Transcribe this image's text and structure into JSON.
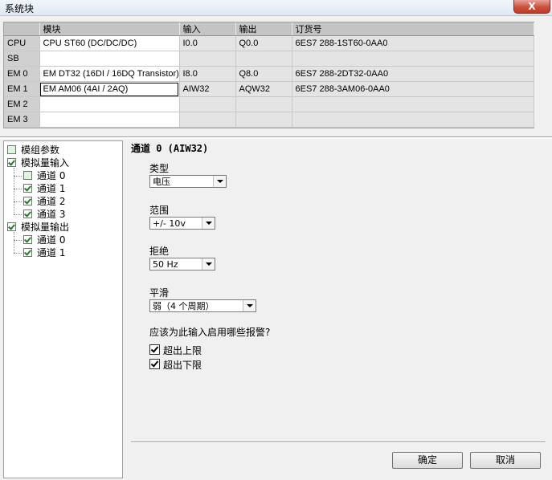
{
  "window": {
    "title": "系统块",
    "close_glyph": "X"
  },
  "table": {
    "headers": [
      "",
      "模块",
      "输入",
      "输出",
      "订货号"
    ],
    "rows": [
      {
        "slot": "CPU",
        "module": "CPU ST60 (DC/DC/DC)",
        "input": "I0.0",
        "output": "Q0.0",
        "order": "6ES7 288-1ST60-0AA0",
        "selected": false
      },
      {
        "slot": "SB",
        "module": "",
        "input": "",
        "output": "",
        "order": "",
        "selected": false
      },
      {
        "slot": "EM 0",
        "module": "EM DT32 (16DI / 16DQ Transistor)",
        "input": "I8.0",
        "output": "Q8.0",
        "order": "6ES7 288-2DT32-0AA0",
        "selected": false
      },
      {
        "slot": "EM 1",
        "module": "EM AM06 (4AI / 2AQ)",
        "input": "AIW32",
        "output": "AQW32",
        "order": "6ES7 288-3AM06-0AA0",
        "selected": true
      },
      {
        "slot": "EM 2",
        "module": "",
        "input": "",
        "output": "",
        "order": "",
        "selected": false
      },
      {
        "slot": "EM 3",
        "module": "",
        "input": "",
        "output": "",
        "order": "",
        "selected": false
      }
    ]
  },
  "tree": {
    "items": [
      {
        "label": "模组参数",
        "checked": false,
        "level": 0
      },
      {
        "label": "模拟量输入",
        "checked": true,
        "level": 0
      },
      {
        "label": "通道 0",
        "checked": false,
        "level": 1
      },
      {
        "label": "通道 1",
        "checked": true,
        "level": 1
      },
      {
        "label": "通道 2",
        "checked": true,
        "level": 1
      },
      {
        "label": "通道 3",
        "checked": true,
        "level": 1
      },
      {
        "label": "模拟量输出",
        "checked": true,
        "level": 0
      },
      {
        "label": "通道 0",
        "checked": true,
        "level": 1
      },
      {
        "label": "通道 1",
        "checked": true,
        "level": 1
      }
    ]
  },
  "panel": {
    "heading": "通道 0 (AIW32)",
    "type_label": "类型",
    "type_value": "电压",
    "range_label": "范围",
    "range_value": "+/- 10v",
    "reject_label": "拒绝",
    "reject_value": "50 Hz",
    "smooth_label": "平滑",
    "smooth_value": "弱（4 个周期）",
    "alarm_question": "应该为此输入启用哪些报警?",
    "alarm_upper_label": "超出上限",
    "alarm_upper_checked": true,
    "alarm_lower_label": "超出下限",
    "alarm_lower_checked": true
  },
  "buttons": {
    "ok": "确定",
    "cancel": "取消"
  }
}
